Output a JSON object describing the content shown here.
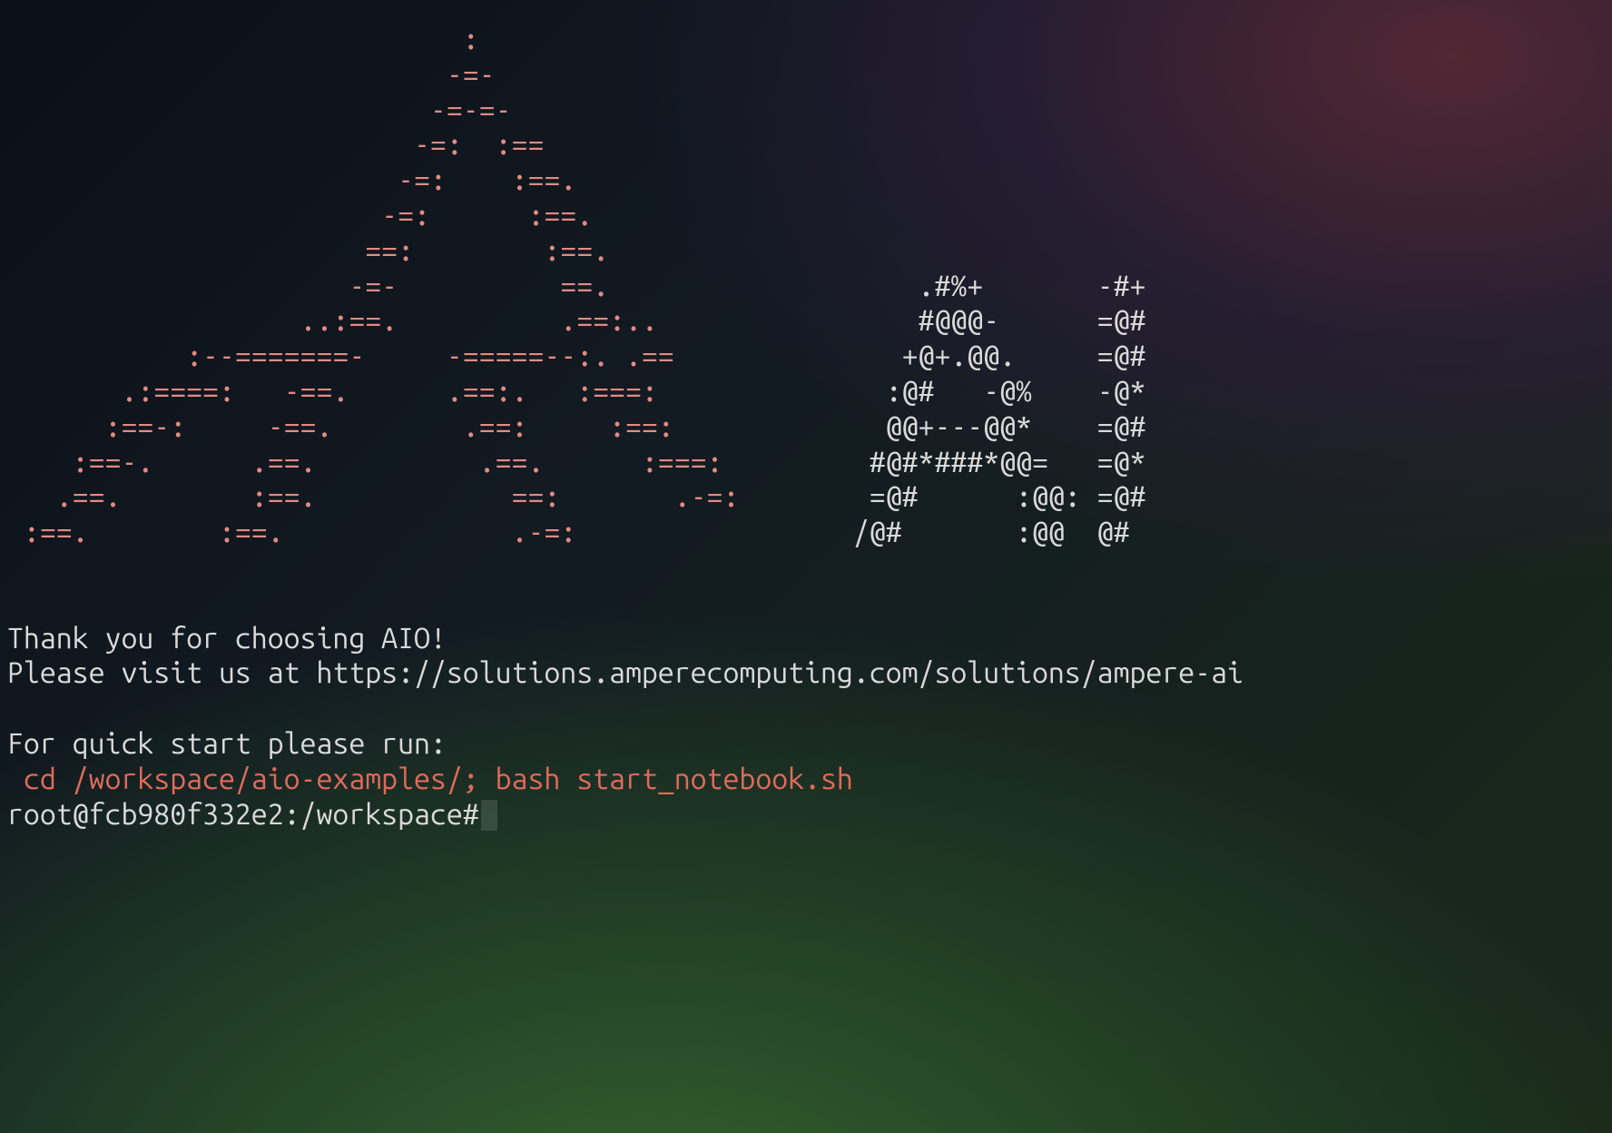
{
  "ascii_art": {
    "red_lines": [
      "                            :",
      "                           -=-",
      "                          -=-=-",
      "                         -=:  :==",
      "                        -=:    :==.",
      "                       -=:      :==.",
      "                      ==:        :==.",
      "                     -=-          ==.",
      "                  ..:==.          .==:..",
      "           :--=======-     -=====--:. .==",
      "       .:====:   -==.      .==:.   :===:",
      "      :==-:     -==.        .==:     :==:",
      "    :==-.      .==.          .==.      :===:",
      "   .==.        :==.            ==:       .-=:",
      " :==.        :==.              .-=:",
      "",
      "",
      "",
      "",
      "",
      "",
      " cd /workspace/aio-examples/; bash start_notebook.sh"
    ],
    "white_lines": [
      "",
      "",
      "",
      "",
      "",
      "",
      "",
      "                                                      .#%+       -#+",
      "                                                      #@@@-      =@#",
      "                                                     +@+.@@.     =@#",
      "                                                    :@#   -@%    -@*",
      "                                                    @@+---@@*    =@#",
      "                                                   #@#*###*@@=   =@*",
      "                                                   =@#      :@@: =@#",
      "                                                  /@#       :@@  @#",
      "",
      "",
      "Thank you for choosing AIO!",
      "Please visit us at https://solutions.amperecomputing.com/solutions/ampere-ai",
      "",
      "For quick start please run:",
      ""
    ],
    "messages": {
      "thank_you": "Thank you for choosing AIO!",
      "visit_us": "Please visit us at https://solutions.amperecomputing.com/solutions/ampere-ai",
      "quick_start_label": "For quick start please run:",
      "quick_start_cmd": " cd /workspace/aio-examples/; bash start_notebook.sh"
    }
  },
  "prompt": {
    "user_host": "root@fcb980f332e2",
    "cwd": "/workspace",
    "full": "root@fcb980f332e2:/workspace#"
  }
}
